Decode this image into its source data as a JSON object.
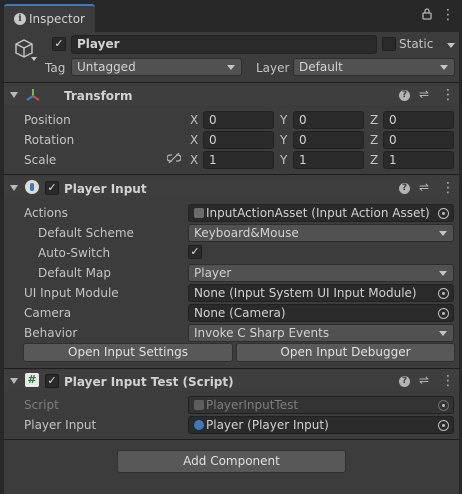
{
  "tab": {
    "label": "Inspector",
    "icons": [
      "lock-icon",
      "more-options-icon"
    ]
  },
  "gameobject": {
    "active": true,
    "name": "Player",
    "static_label": "Static",
    "static": false,
    "tag_label": "Tag",
    "tag_value": "Untagged",
    "layer_label": "Layer",
    "layer_value": "Default"
  },
  "transform": {
    "title": "Transform",
    "rows": [
      {
        "label": "Position",
        "x": "0",
        "y": "0",
        "z": "0"
      },
      {
        "label": "Rotation",
        "x": "0",
        "y": "0",
        "z": "0"
      },
      {
        "label": "Scale",
        "x": "1",
        "y": "1",
        "z": "1"
      }
    ],
    "axis": {
      "x": "X",
      "y": "Y",
      "z": "Z"
    }
  },
  "player_input": {
    "title": "Player Input",
    "enabled": true,
    "actions_label": "Actions",
    "actions_value": "InputActionAsset (Input Action Asset)",
    "default_scheme_label": "Default Scheme",
    "default_scheme_value": "Keyboard&Mouse",
    "auto_switch_label": "Auto-Switch",
    "auto_switch": true,
    "default_map_label": "Default Map",
    "default_map_value": "Player",
    "ui_module_label": "UI Input Module",
    "ui_module_value": "None (Input System UI Input Module)",
    "camera_label": "Camera",
    "camera_value": "None (Camera)",
    "behavior_label": "Behavior",
    "behavior_value": "Invoke C Sharp Events",
    "open_settings": "Open Input Settings",
    "open_debugger": "Open Input Debugger"
  },
  "player_input_test": {
    "title": "Player Input Test (Script)",
    "enabled": true,
    "script_label": "Script",
    "script_value": "PlayerInputTest",
    "player_input_label": "Player Input",
    "player_input_value": "Player (Player Input)"
  },
  "add_component": "Add Component",
  "colors": {
    "tab_accent": "#3a79bb",
    "panel_bg": "#3c3c3c",
    "field_bg": "#2a2a2a"
  }
}
